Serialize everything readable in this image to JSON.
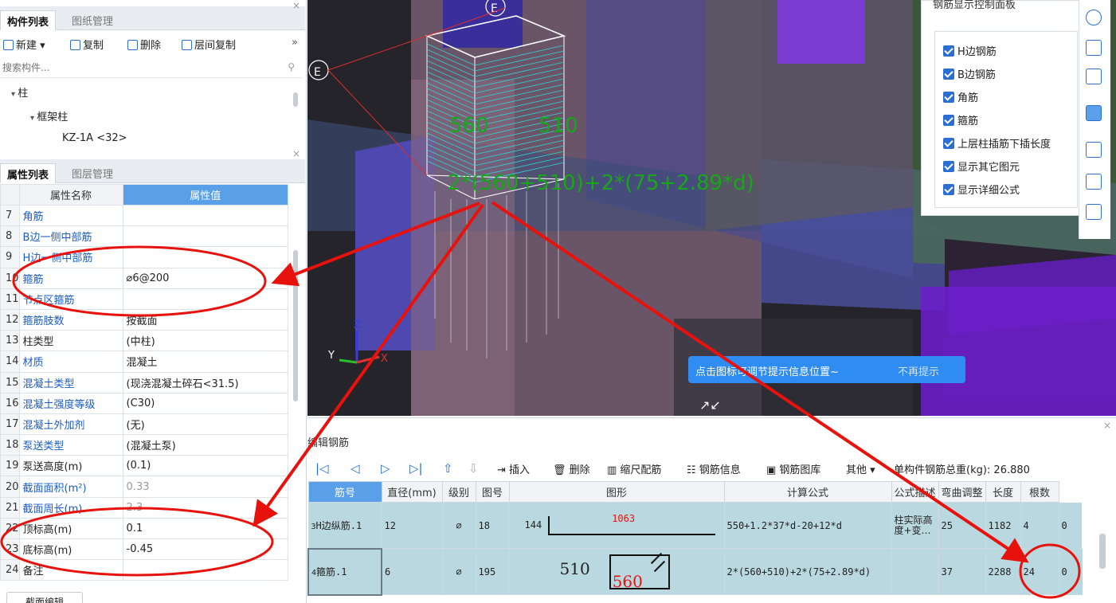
{
  "component_panel": {
    "tabs": [
      "构件列表",
      "图纸管理"
    ],
    "toolbar": {
      "new_label": "新建",
      "copy_label": "复制",
      "delete_label": "删除",
      "floor_copy_label": "层间复制",
      "more": "»"
    },
    "search_placeholder": "搜索构件...",
    "tree": {
      "root": "柱",
      "group": "框架柱",
      "item": "KZ-1A <32>"
    }
  },
  "property_panel": {
    "tabs": [
      "属性列表",
      "图层管理"
    ],
    "columns": [
      "属性名称",
      "属性值"
    ],
    "rows": [
      {
        "num": "7",
        "name": "角筋",
        "value": ""
      },
      {
        "num": "8",
        "name": "B边一侧中部筋",
        "value": ""
      },
      {
        "num": "9",
        "name": "H边一侧中部筋",
        "value": ""
      },
      {
        "num": "10",
        "name": "箍筋",
        "value": "⌀6@200"
      },
      {
        "num": "11",
        "name": "节点区箍筋",
        "value": ""
      },
      {
        "num": "12",
        "name": "箍筋肢数",
        "value": "按截面"
      },
      {
        "num": "13",
        "name": "柱类型",
        "value": "(中柱)"
      },
      {
        "num": "14",
        "name": "材质",
        "value": "混凝土"
      },
      {
        "num": "15",
        "name": "混凝土类型",
        "value": "(现浇混凝土碎石<31.5)"
      },
      {
        "num": "16",
        "name": "混凝土强度等级",
        "value": "(C30)"
      },
      {
        "num": "17",
        "name": "混凝土外加剂",
        "value": "(无)"
      },
      {
        "num": "18",
        "name": "泵送类型",
        "value": "(混凝土泵)"
      },
      {
        "num": "19",
        "name": "泵送高度(m)",
        "value": "(0.1)"
      },
      {
        "num": "20",
        "name": "截面面积(m²)",
        "value": "0.33"
      },
      {
        "num": "21",
        "name": "截面周长(m)",
        "value": "2.3"
      },
      {
        "num": "22",
        "name": "顶标高(m)",
        "value": "0.1"
      },
      {
        "num": "23",
        "name": "底标高(m)",
        "value": "-0.45"
      },
      {
        "num": "24",
        "name": "备注",
        "value": ""
      }
    ],
    "section_edit_label": "截面编辑"
  },
  "view3d": {
    "axis_label": "E",
    "dim_560": "560",
    "dim_510": "510",
    "formula_overlay": "2*(560+510)+2*(75+2.89*d)",
    "tip_text": "点击图标可调节提示信息位置~",
    "tip_dismiss": "不再提示"
  },
  "rebar_display_panel": {
    "title": "钢筋显示控制面板",
    "options": [
      "H边钢筋",
      "B边钢筋",
      "角筋",
      "箍筋",
      "上层柱插筋下插长度",
      "显示其它图元",
      "显示详细公式"
    ]
  },
  "edit_rebar": {
    "title": "编辑钢筋",
    "toolbar": {
      "insert_label": "插入",
      "delete_label": "删除",
      "scale_label": "缩尺配筋",
      "info_label": "钢筋信息",
      "library_label": "钢筋图库",
      "other_label": "其他",
      "total_weight": "单构件钢筋总重(kg): 26.880"
    },
    "columns": [
      "筋号",
      "直径(mm)",
      "级别",
      "图号",
      "图形",
      "计算公式",
      "公式描述",
      "弯曲调整",
      "长度",
      "根数"
    ],
    "rows": [
      {
        "index": "3",
        "name": "H边纵筋.1",
        "diameter": "12",
        "grade": "⌀",
        "fig_no": "18",
        "shape_left": "144",
        "shape_top": "1063",
        "formula": "550+1.2*37*d-20+12*d",
        "description": "柱实际高度+变…",
        "bend": "25",
        "length": "1182",
        "count": "4",
        "extra": "0"
      },
      {
        "index": "4",
        "name": "箍筋.1",
        "diameter": "6",
        "grade": "⌀",
        "fig_no": "195",
        "shape_left": "510",
        "shape_top": "560",
        "formula": "2*(560+510)+2*(75+2.89*d)",
        "description": "",
        "bend": "37",
        "length": "2288",
        "count": "24",
        "extra": "0"
      }
    ]
  },
  "colors": {
    "accent_blue": "#2a6fd1",
    "header_blue": "#5aa0e8",
    "annotation_red": "#e8120c",
    "rebar_green": "#19a519",
    "row_teal": "#b9d8df"
  }
}
